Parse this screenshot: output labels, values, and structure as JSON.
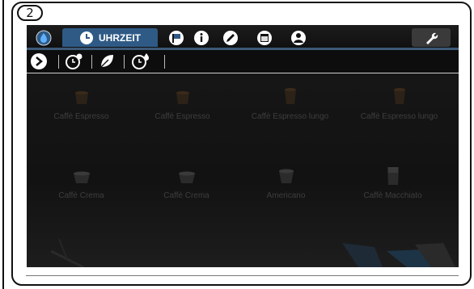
{
  "step": {
    "number": "2"
  },
  "topbar": {
    "tabs": [
      {
        "icon": "water-drop-icon"
      },
      {
        "icon": "clock-icon",
        "label": "UHRZEIT",
        "active": true
      },
      {
        "icon": "flag-icon"
      },
      {
        "icon": "info-icon"
      },
      {
        "icon": "pencil-icon"
      },
      {
        "icon": "calendar-icon"
      },
      {
        "icon": "person-icon"
      }
    ],
    "settings_icon": "wrench-icon",
    "accent": "#2f5a86"
  },
  "subbar": {
    "items": [
      {
        "icon": "arrow-right-icon"
      },
      {
        "icon": "timer-icon"
      },
      {
        "icon": "eco-leaf-icon"
      },
      {
        "icon": "clock-drop-icon"
      }
    ]
  },
  "beverages": [
    {
      "name": "Caffè Espresso"
    },
    {
      "name": "Caffè Espresso"
    },
    {
      "name": "Caffè Espresso lungo"
    },
    {
      "name": "Caffè Espresso lungo"
    },
    {
      "name": "Caffè Crema"
    },
    {
      "name": "Caffè Crema"
    },
    {
      "name": "Americano"
    },
    {
      "name": "Caffè Macchiato"
    }
  ]
}
